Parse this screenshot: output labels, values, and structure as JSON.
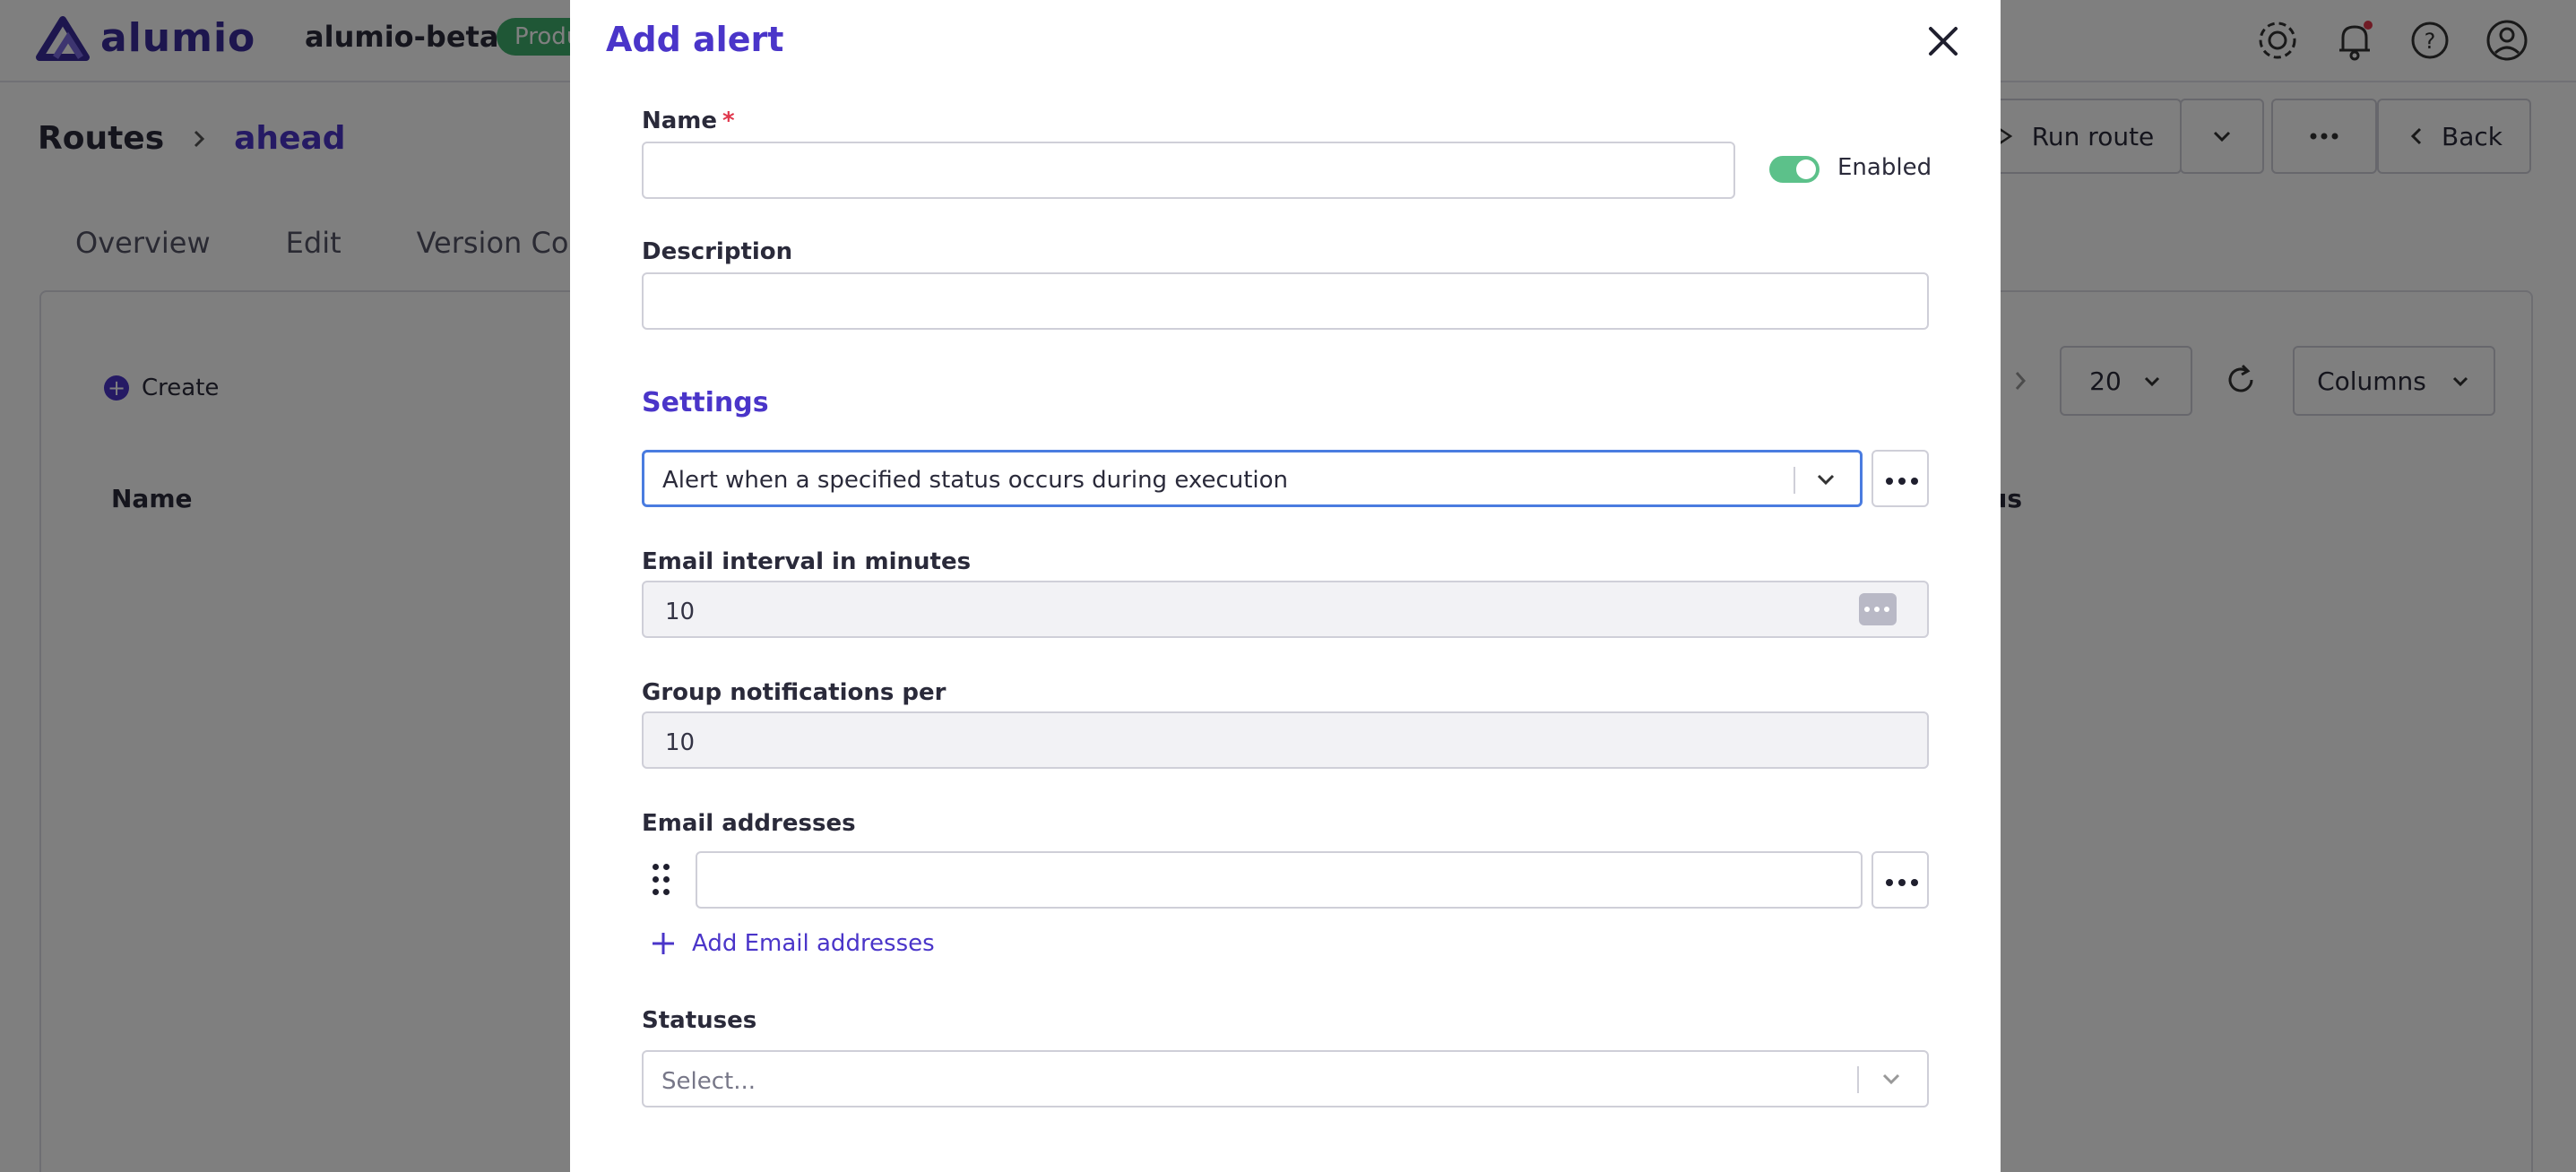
{
  "app": {
    "logo_text": "alumio",
    "workspace": "alumio-beta",
    "environment_badge": "Produ"
  },
  "breadcrumb": {
    "root": "Routes",
    "current": "ahead"
  },
  "tabs": [
    {
      "label": "Overview"
    },
    {
      "label": "Edit"
    },
    {
      "label": "Version Co"
    }
  ],
  "toolbar": {
    "run_route": "Run route",
    "back": "Back",
    "page_size": "20",
    "columns": "Columns"
  },
  "list": {
    "create": "Create",
    "col_name": "Name",
    "col_status": "tus"
  },
  "modal": {
    "title": "Add alert",
    "name_label": "Name",
    "required_mark": "*",
    "name_value": "",
    "enabled_label": "Enabled",
    "enabled": true,
    "description_label": "Description",
    "description_value": "",
    "settings_heading": "Settings",
    "alert_type": "Alert when a specified status occurs during execution",
    "email_interval_label": "Email interval in minutes",
    "email_interval_value": "10",
    "group_label": "Group notifications per",
    "group_value": "10",
    "email_addresses_label": "Email addresses",
    "email_address_value": "",
    "add_email_label": "Add Email addresses",
    "statuses_label": "Statuses",
    "statuses_placeholder": "Select..."
  },
  "colors": {
    "accent": "#4a35c9",
    "toggle_on": "#5cc18a",
    "focus_border": "#4a7ce0",
    "required": "#e0364b",
    "badge": "#3fae6c"
  },
  "icons": {
    "settings": "gear-icon",
    "notifications": "bell-icon",
    "help": "help-icon",
    "account": "user-icon",
    "close": "close-icon",
    "more": "more-icon",
    "dropdown": "chevron-down-icon",
    "add": "plus-icon",
    "drag": "drag-handle-icon",
    "refresh": "refresh-icon"
  }
}
